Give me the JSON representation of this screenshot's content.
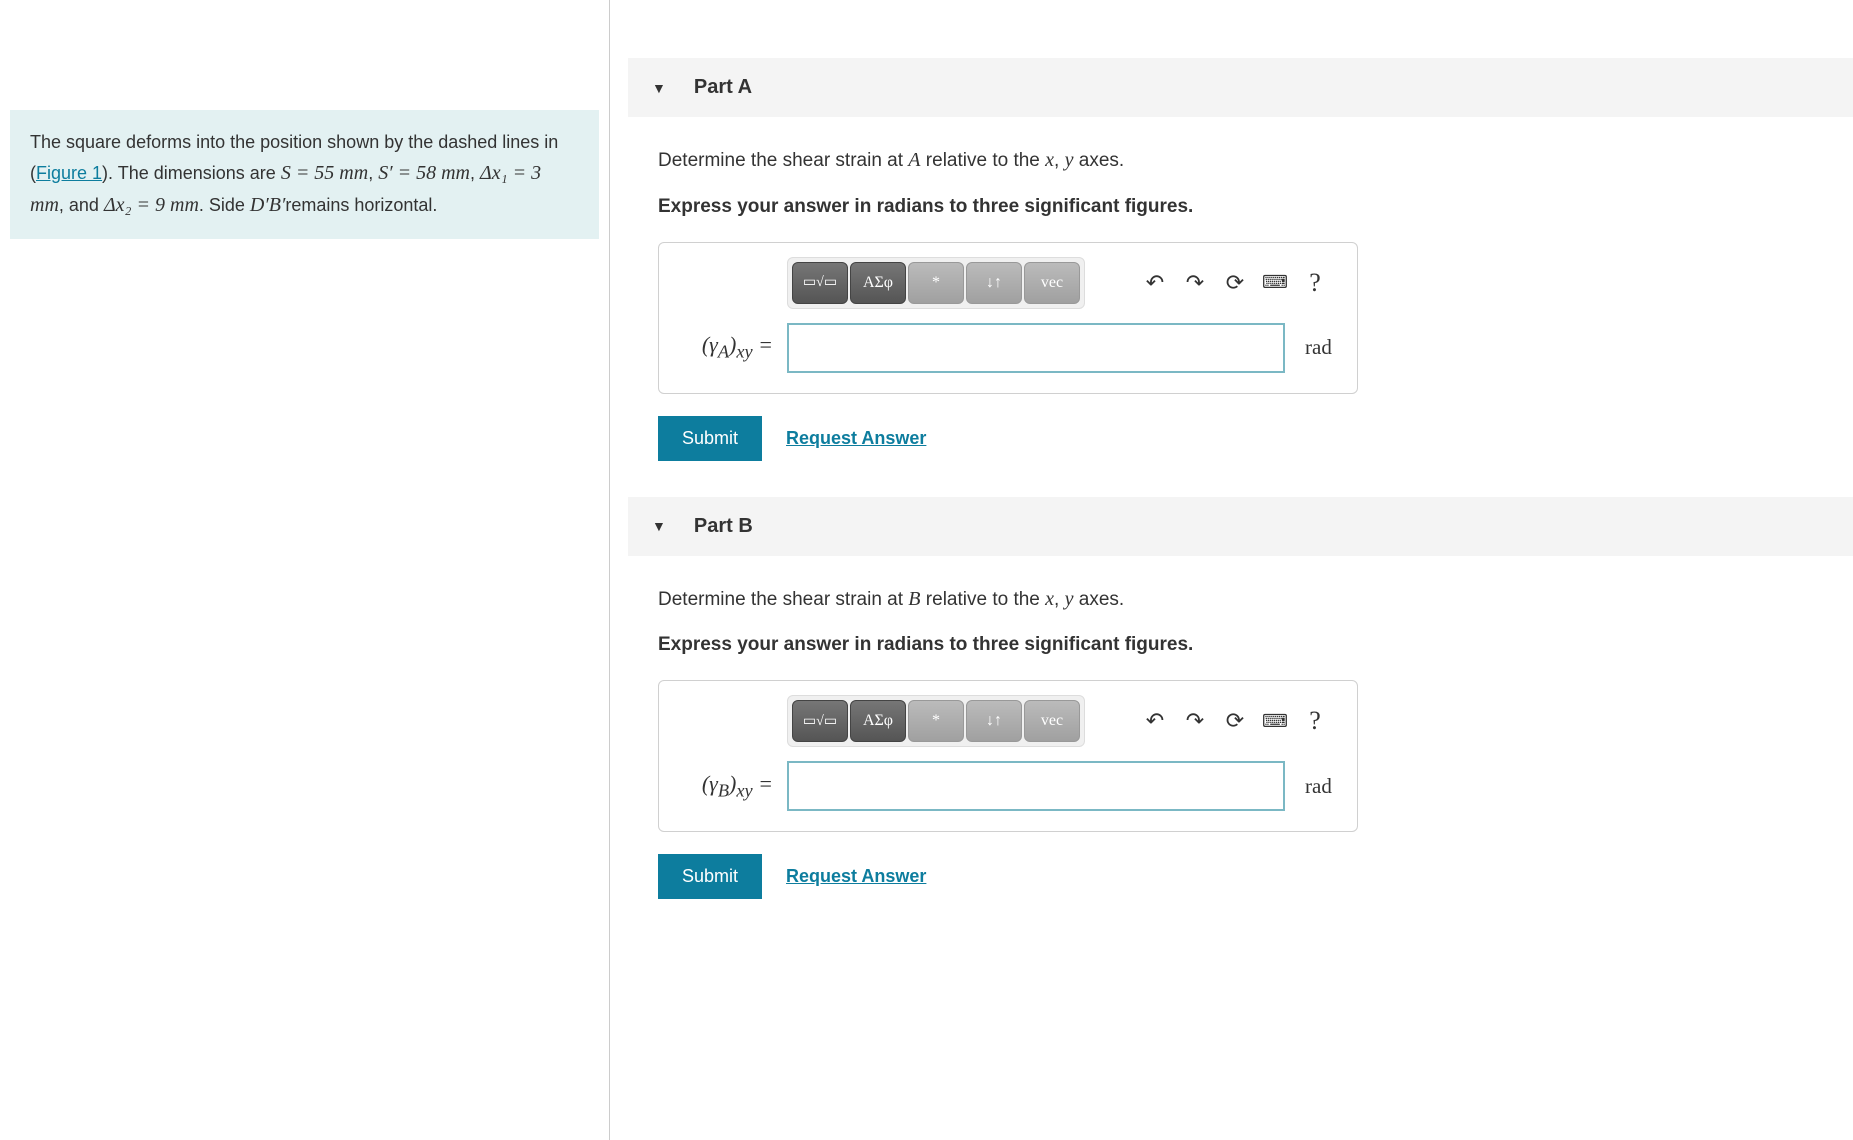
{
  "problem": {
    "text_prefix": "The square deforms into the position shown by the dashed lines in (",
    "figure_link": "Figure 1",
    "text_after_figure": "). The dimensions are ",
    "eq1": "S = 55 mm",
    "sep1": ", ",
    "eq2": "S′ = 58 mm",
    "sep2": ", ",
    "eq3": "Δx₁ = 3 mm",
    "sep3": ", and ",
    "eq4": "Δx₂ = 9 mm",
    "text_after_eq": ". Side ",
    "side_label": "D′B′",
    "text_end": "remains horizontal."
  },
  "parts": [
    {
      "id": "A",
      "title": "Part A",
      "question_prefix": "Determine the shear strain at ",
      "question_point": "A",
      "question_suffix": " relative to the ",
      "ax1": "x",
      "ax_sep": ", ",
      "ax2": "y",
      "question_end": " axes.",
      "instruction": "Express your answer in radians to three significant figures.",
      "var_label": "(γA)xy =",
      "unit": "rad",
      "value": "",
      "submit": "Submit",
      "request": "Request Answer"
    },
    {
      "id": "B",
      "title": "Part B",
      "question_prefix": "Determine the shear strain at ",
      "question_point": "B",
      "question_suffix": " relative to the ",
      "ax1": "x",
      "ax_sep": ", ",
      "ax2": "y",
      "question_end": " axes.",
      "instruction": "Express your answer in radians to three significant figures.",
      "var_label": "(γB)xy =",
      "unit": "rad",
      "value": "",
      "submit": "Submit",
      "request": "Request Answer"
    }
  ],
  "toolbar": {
    "templates": "▭√▭",
    "greek": "ΑΣφ",
    "special": "*",
    "subsup": "↓↑",
    "vec": "vec",
    "undo": "↶",
    "redo": "↷",
    "reset": "⟳",
    "keyboard": "⌨",
    "help": "?"
  }
}
